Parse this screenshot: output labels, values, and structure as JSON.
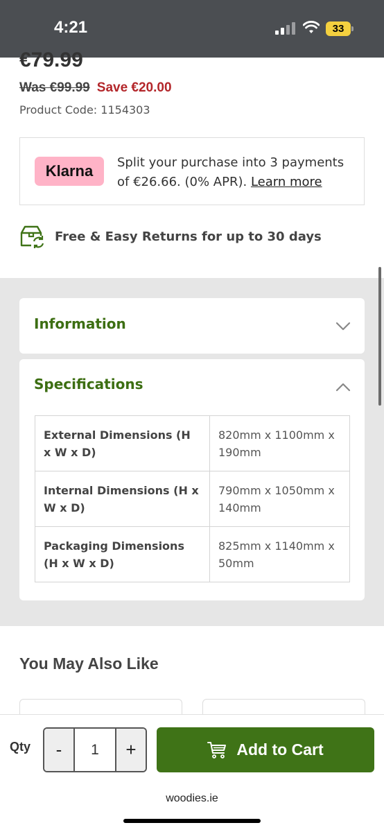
{
  "status_bar": {
    "time": "4:21",
    "battery": "33"
  },
  "product": {
    "price": "€79.99",
    "was_price": "Was €99.99",
    "save_text": "Save €20.00",
    "product_code": "Product Code: 1154303"
  },
  "klarna": {
    "logo_text": "Klarna",
    "message": "Split your purchase into 3 payments of €26.66. (0% APR). ",
    "link": "Learn more"
  },
  "returns": {
    "text": "Free & Easy Returns for up to 30 days"
  },
  "accordion": {
    "information": {
      "title": "Information",
      "expanded": false
    },
    "specifications": {
      "title": "Specifications",
      "expanded": true,
      "rows": [
        {
          "label": "External Dimensions (H x W x D)",
          "value": "820mm x 1100mm x 190mm"
        },
        {
          "label": "Internal Dimensions (H x W x D)",
          "value": "790mm x 1050mm x 140mm"
        },
        {
          "label": "Packaging Dimensions (H x W x D)",
          "value": "825mm x 1140mm x 50mm"
        }
      ]
    }
  },
  "also_like": {
    "title": "You May Also Like"
  },
  "cart_bar": {
    "qty_label": "Qty",
    "minus": "-",
    "qty_value": "1",
    "plus": "+",
    "add_to_cart": "Add to Cart"
  },
  "browser": {
    "url": "woodies.ie"
  },
  "colors": {
    "brand_green": "#3f7317",
    "heading_green": "#3c6e12",
    "sale_red": "#b3262a",
    "klarna_pink": "#ffb3c7"
  },
  "icons": {
    "returns": "box-return-icon",
    "info_chevron": "chevron-down-icon",
    "spec_chevron": "chevron-up-icon",
    "cart": "shopping-cart-icon"
  }
}
